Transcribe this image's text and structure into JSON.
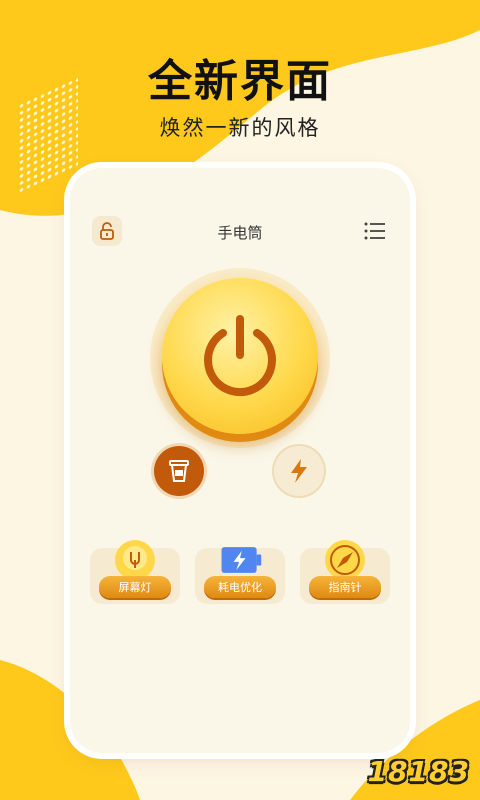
{
  "promo": {
    "title": "全新界面",
    "subtitle": "焕然一新的风格"
  },
  "app": {
    "title": "手电筒",
    "lock_icon": "lock-open-icon",
    "menu_icon": "list-menu-icon",
    "power_icon": "power-icon",
    "sos_icon": "cup-icon",
    "flash_icon": "lightning-icon"
  },
  "tools": [
    {
      "label": "屏幕灯",
      "icon": "lightbulb-icon"
    },
    {
      "label": "耗电优化",
      "icon": "battery-icon"
    },
    {
      "label": "指南针",
      "icon": "compass-icon"
    }
  ],
  "watermark": "18183",
  "colors": {
    "accent": "#ffd84a",
    "accent_dark": "#e08a12",
    "brown": "#c25a0c",
    "background": "#fdf6e3"
  }
}
